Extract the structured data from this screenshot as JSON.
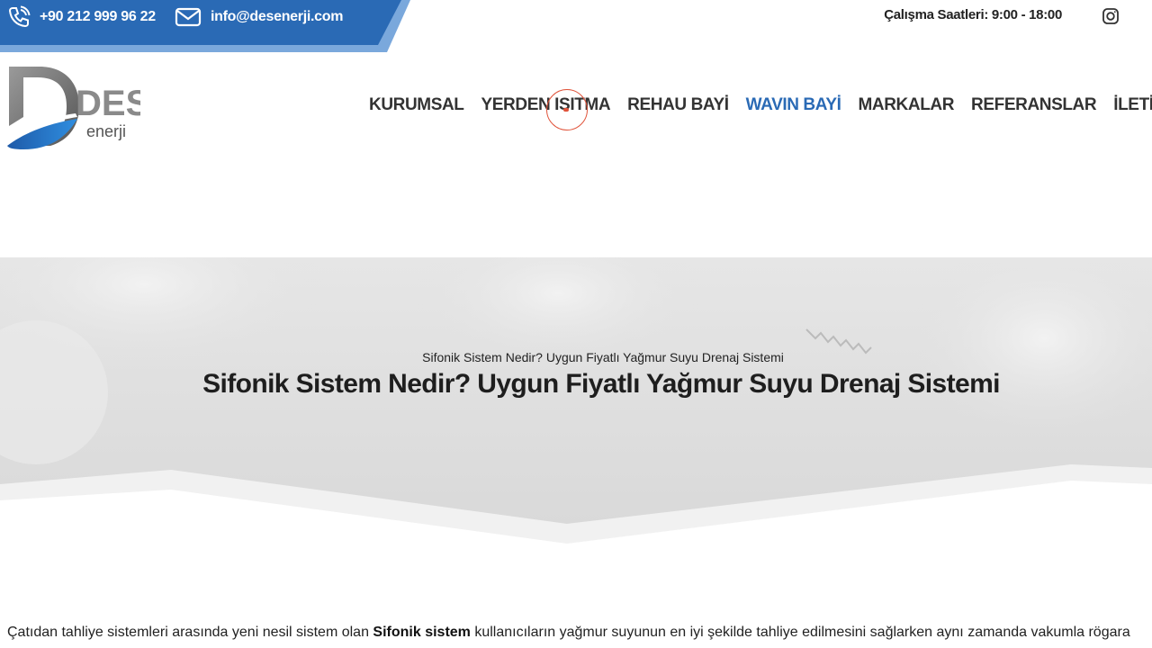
{
  "topbar": {
    "phone": "+90 212 999 96 22",
    "email": "info@desenerji.com",
    "hours": "Çalışma Saatleri: 9:00 - 18:00",
    "colors": {
      "blue": "#2a6ab5",
      "light_blue": "#7aa8dc"
    },
    "icons": {
      "phone": "phone-icon",
      "email": "mail-icon",
      "social": "instagram-icon"
    }
  },
  "logo": {
    "letters": "DES",
    "sub": "enerji"
  },
  "nav": {
    "items": [
      {
        "label": "KURUMSAL",
        "active": false
      },
      {
        "label": "YERDEN ISITMA",
        "active": false
      },
      {
        "label": "REHAU BAYİ",
        "active": false
      },
      {
        "label": "WAVIN BAYİ",
        "active": true
      },
      {
        "label": "MARKALAR",
        "active": false
      },
      {
        "label": "REFERANSLAR",
        "active": false
      },
      {
        "label": "İLETİŞİM",
        "active": false
      }
    ],
    "active_color": "#2a6ab5"
  },
  "hero": {
    "breadcrumb": "Sifonik Sistem Nedir? Uygun Fiyatlı Yağmur Suyu Drenaj Sistemi",
    "title": "Sifonik Sistem Nedir? Uygun Fiyatlı Yağmur Suyu Drenaj Sistemi"
  },
  "content": {
    "before": "Çatıdan tahliye sistemleri arasında yeni nesil sistem olan ",
    "bold": "Sifonik sistem",
    "after": " kullanıcıların yağmur suyunun en iyi şekilde tahliye edilmesini sağlarken aynı zamanda vakumla rögara"
  }
}
